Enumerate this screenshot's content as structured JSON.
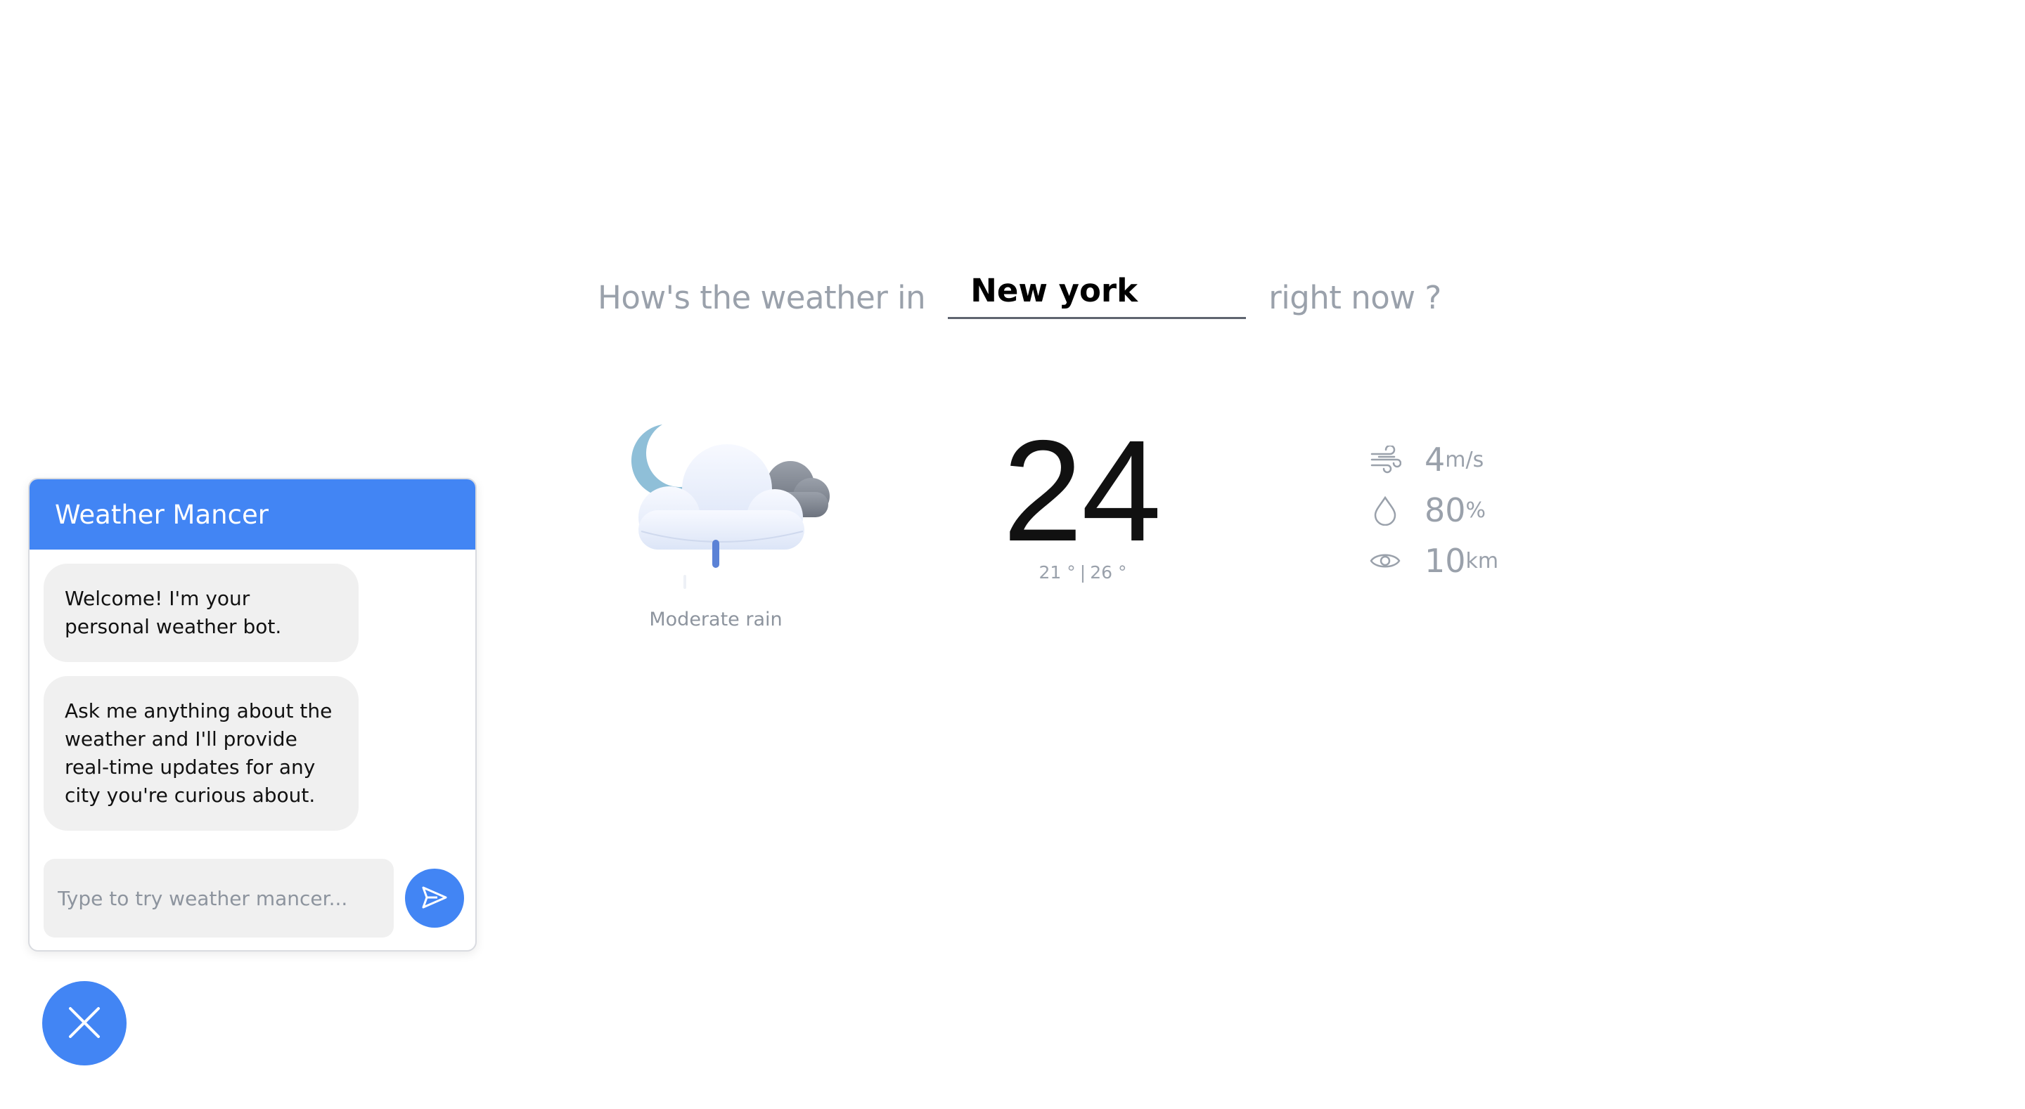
{
  "query": {
    "prefix": "How's the weather in",
    "city_value": "New york",
    "suffix": "right now ?"
  },
  "weather": {
    "icon": "night-cloudy-rain-icon",
    "condition": "Moderate rain",
    "temperature": "24",
    "temp_min": "21 °",
    "separator": "|",
    "temp_max": "26 °"
  },
  "stats": {
    "wind": {
      "icon": "wind-icon",
      "value": "4",
      "unit": "m/s"
    },
    "humidity": {
      "icon": "droplet-icon",
      "value": "80",
      "unit": "%"
    },
    "visibility": {
      "icon": "eye-icon",
      "value": "10",
      "unit": "km"
    }
  },
  "chat": {
    "title": "Weather Mancer",
    "messages": [
      "Welcome! I'm your personal weather bot.",
      "Ask me anything about the weather and I'll provide real-time updates for any city you're curious about."
    ],
    "input_placeholder": "Type to try weather mancer...",
    "send_icon": "send-icon",
    "toggle_icon": "close-icon"
  },
  "colors": {
    "accent": "#4285f4",
    "muted_text": "#9aa1ab",
    "bubble_bg": "#f0f0f0"
  }
}
